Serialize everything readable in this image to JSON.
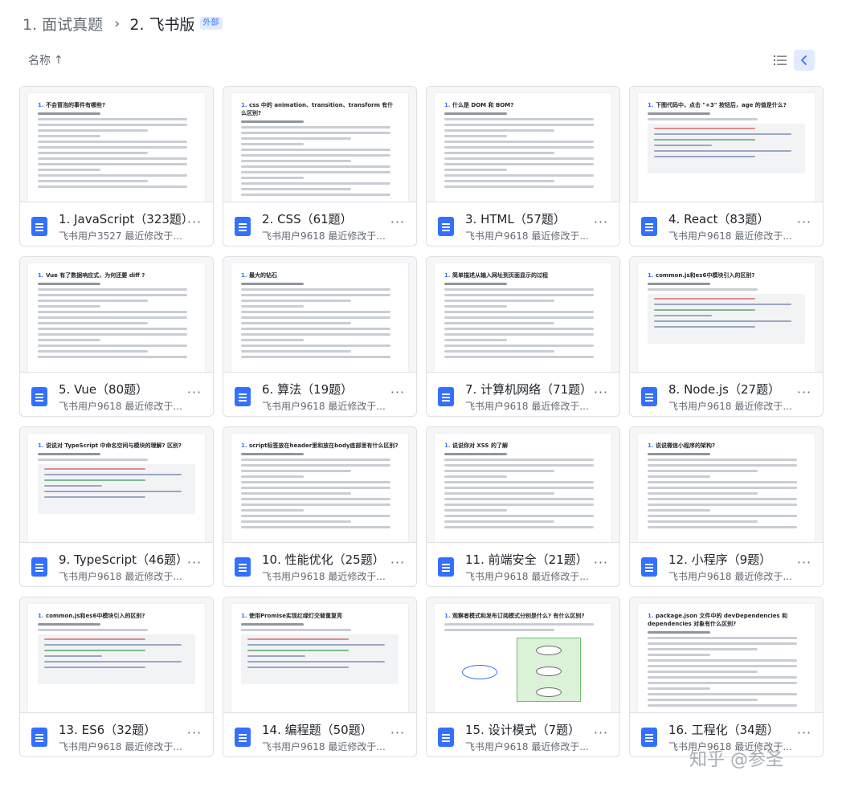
{
  "breadcrumb": {
    "parent": "1. 面试真题",
    "separator": "›",
    "current": "2. 飞书版",
    "badge": "外部"
  },
  "toolbar": {
    "sort_label": "名称",
    "sort_arrow": "↑"
  },
  "cards": [
    {
      "name": "1. JavaScript（323题）",
      "meta": "飞书用户3527 最近修改于...",
      "preview_title": "不会冒泡的事件有哪些?",
      "preview_num": "1.",
      "preview_kind": "text"
    },
    {
      "name": "2. CSS（61题）",
      "meta": "飞书用户9618 最近修改于...",
      "preview_title": "css 中的 animation、transition、transform 有什么区别?",
      "preview_num": "1.",
      "preview_kind": "text"
    },
    {
      "name": "3. HTML（57题）",
      "meta": "飞书用户9618 最近修改于...",
      "preview_title": "什么是 DOM 和 BOM?",
      "preview_num": "1.",
      "preview_kind": "text"
    },
    {
      "name": "4. React（83题）",
      "meta": "飞书用户9618 最近修改于...",
      "preview_title": "下图代码中，点击 \"+3\" 按钮后，age 的值是什么?",
      "preview_num": "1.",
      "preview_kind": "code"
    },
    {
      "name": "5. Vue（80题）",
      "meta": "飞书用户9618 最近修改于...",
      "preview_title": "Vue 有了数据响应式，为何还要 diff ?",
      "preview_num": "1.",
      "preview_kind": "text"
    },
    {
      "name": "6. 算法（19题）",
      "meta": "飞书用户9618 最近修改于...",
      "preview_title": "最大的钻石",
      "preview_num": "1.",
      "preview_kind": "text"
    },
    {
      "name": "7. 计算机网络（71题）",
      "meta": "飞书用户9618 最近修改于...",
      "preview_title": "简单描述从输入网址到页面显示的过程",
      "preview_num": "1.",
      "preview_kind": "text"
    },
    {
      "name": "8. Node.js（27题）",
      "meta": "飞书用户9618 最近修改于...",
      "preview_title": "common.js和es6中模块引入的区别?",
      "preview_num": "1.",
      "preview_kind": "code"
    },
    {
      "name": "9. TypeScript（46题）",
      "meta": "飞书用户9618 最近修改于...",
      "preview_title": "说说对 TypeScript 中命名空间与模块的理解? 区别?",
      "preview_num": "1.",
      "preview_kind": "code"
    },
    {
      "name": "10. 性能优化（25题）",
      "meta": "飞书用户9618 最近修改于...",
      "preview_title": "script标签放在header里和放在body底部里有什么区别?",
      "preview_num": "1.",
      "preview_kind": "text"
    },
    {
      "name": "11. 前端安全（21题）",
      "meta": "飞书用户9618 最近修改于...",
      "preview_title": "说说你对 XSS 的了解",
      "preview_num": "1.",
      "preview_kind": "text"
    },
    {
      "name": "12. 小程序（9题）",
      "meta": "飞书用户9618 最近修改于...",
      "preview_title": "说说微信小程序的架构?",
      "preview_num": "1.",
      "preview_kind": "text"
    },
    {
      "name": "13. ES6（32题）",
      "meta": "飞书用户9618 最近修改于...",
      "preview_title": "common.js和es6中模块引入的区别?",
      "preview_num": "1.",
      "preview_kind": "code"
    },
    {
      "name": "14. 编程题（50题）",
      "meta": "飞书用户9618 最近修改于...",
      "preview_title": "使用Promise实现红绿灯交替重复亮",
      "preview_num": "1.",
      "preview_kind": "code"
    },
    {
      "name": "15. 设计模式（7题）",
      "meta": "飞书用户9618 最近修改于...",
      "preview_title": "观察者模式和发布订阅模式分别是什么? 有什么区别?",
      "preview_num": "1.",
      "preview_kind": "diagram"
    },
    {
      "name": "16. 工程化（34题）",
      "meta": "飞书用户9618 最近修改于...",
      "preview_title": "package.json 文件中的 devDependencies 和 dependencies 对象有什么区别?",
      "preview_num": "1.",
      "preview_kind": "text"
    }
  ],
  "watermark": "知乎 @参圣",
  "colors": {
    "accent": "#3370ff",
    "badge_bg": "#e1eaff",
    "card_border": "#dee0e3",
    "meta_text": "#646a73"
  },
  "icons": {
    "sort": "arrow-up-icon",
    "list_view": "list-view-icon",
    "collapse": "chevron-left-icon",
    "doc": "doc-file-icon",
    "more": "more-horizontal-icon"
  }
}
